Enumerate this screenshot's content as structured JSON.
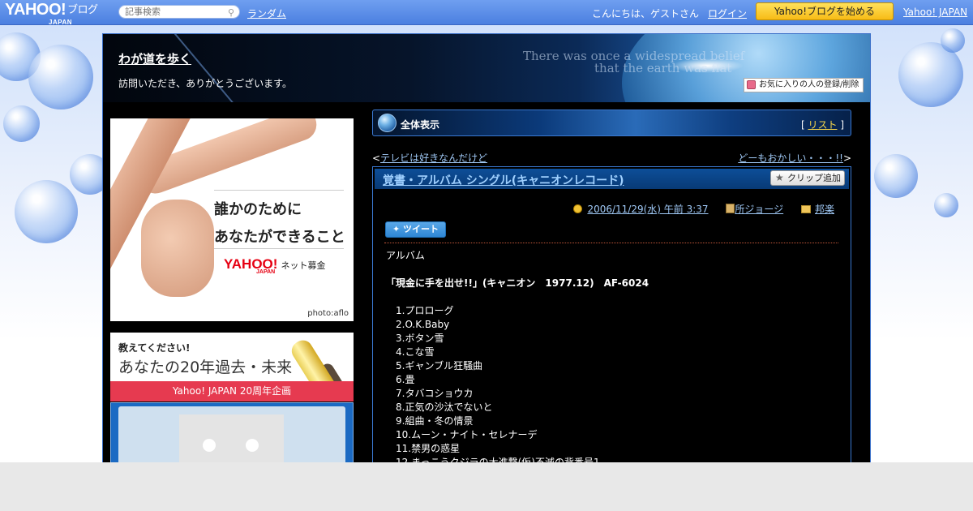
{
  "topbar": {
    "logo_text": "YAHOO!",
    "logo_sub": "JAPAN",
    "logo_blog": "ブログ",
    "search_placeholder": "記事検索",
    "random_link": "ランダム",
    "greeting": "こんにちは、ゲストさん",
    "login_link": "ログイン",
    "start_blog_button": "Yahoo!ブログを始める",
    "yahoo_japan_link": "Yahoo! JAPAN"
  },
  "blog": {
    "title": "わが道を歩く",
    "description": "訪問いただき、ありがとうございます。",
    "header_quote": [
      "There was once a widespread belief",
      "that the earth was flat"
    ],
    "favorite_button": "お気に入りの人の登録/削除"
  },
  "ads": {
    "donation": {
      "line1": "誰かのために",
      "line2": "あなたができること",
      "brand": "YAHOO!",
      "brand_sub": "JAPAN",
      "brand_suffix": "ネット募金",
      "credit": "photo:aflo"
    },
    "anniversary": {
      "line1": "教えてください!",
      "line2": "あなたの20年過去・未来",
      "band": "Yahoo! JAPAN 20周年企画"
    }
  },
  "section": {
    "label": "全体表示",
    "list_open": "[",
    "list_link": "リスト",
    "list_close": "]"
  },
  "nav": {
    "prev_marker": "<",
    "prev_link": "テレビは好きなんだけど",
    "next_link": "どーもおかしい・・・!!",
    "next_marker": ">"
  },
  "article": {
    "title": "覚書・アルバム シングル(キャニオンレコード)",
    "clip_button": "クリップ追加",
    "date": "2006/11/29(水) 午前 3:37",
    "author": "所ジョージ",
    "category": "邦楽",
    "tweet_button": "ツイート",
    "type_label": "アルバム",
    "album_title": "「現金に手を出せ!!」(キャニオン　1977.12)　AF-6024",
    "tracks": [
      "1.プロローグ",
      "2.O.K.Baby",
      "3.ボタン雪",
      "4.こな雪",
      "5.ギャンブル狂騒曲",
      "6.畳",
      "7.タバコショウカ",
      "8.正気の沙汰でないと",
      "9.組曲・冬の情景",
      "10.ムーン・ナイト・セレナーデ",
      "11.禁男の惑星",
      "12.まっこうクジラの大進撃(仮)不滅の背番号1"
    ]
  },
  "colors": {
    "topbar": "#4b7fe0",
    "start_button": "#f7bb16",
    "link_blue": "#9fc8f5",
    "frame_border": "#3a6fc8"
  }
}
